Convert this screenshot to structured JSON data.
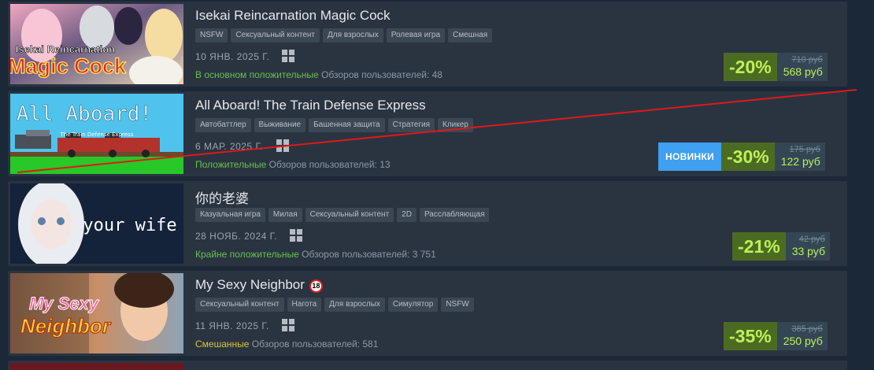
{
  "games": [
    {
      "title": "Isekai Reincarnation Magic Cock",
      "capsule_text": [
        "Isekai Reincarnation",
        "Magic Cock"
      ],
      "tags": [
        "NSFW",
        "Сексуальный контент",
        "Для взрослых",
        "Ролевая игра",
        "Смешная"
      ],
      "date": "10 ЯНВ. 2025 Г.",
      "review_summary": "В основном положительные",
      "review_count": "Обзоров пользователей: 48",
      "discount": "-20%",
      "original_price": "710 руб",
      "final_price": "568 руб"
    },
    {
      "title": "All Aboard! The Train Defense Express",
      "capsule_text": [
        "All Aboard!",
        "The Train Defense Express"
      ],
      "tags": [
        "Автобаттлер",
        "Выживание",
        "Башенная защита",
        "Стратегия",
        "Кликер"
      ],
      "date": "6 МАР. 2025 Г.",
      "review_summary": "Положительные",
      "review_count": "Обзоров пользователей: 13",
      "new_label": "НОВИНКИ",
      "discount": "-30%",
      "original_price": "175 руб",
      "final_price": "122 руб"
    },
    {
      "title": "你的老婆",
      "capsule_text": [
        "your wife"
      ],
      "tags": [
        "Казуальная игра",
        "Милая",
        "Сексуальный контент",
        "2D",
        "Расслабляющая"
      ],
      "date": "28 НОЯБ. 2024 Г.",
      "review_summary": "Крайне положительные",
      "review_count": "Обзоров пользователей: 3 751",
      "discount": "-21%",
      "original_price": "42 руб",
      "final_price": "33 руб"
    },
    {
      "title": "My Sexy Neighbor",
      "age_badge": "18",
      "capsule_text": [
        "My Sexy",
        "Neighbor"
      ],
      "tags": [
        "Сексуальный контент",
        "Нагота",
        "Для взрослых",
        "Симулятор",
        "NSFW"
      ],
      "date": "11 ЯНВ. 2025 Г.",
      "review_summary": "Смешанные",
      "review_count": "Обзоров пользователей: 581",
      "discount": "-35%",
      "original_price": "385 руб",
      "final_price": "250 руб"
    }
  ],
  "icons": {
    "platform": "windows-icon"
  },
  "colors": {
    "background": "#1b2838",
    "row": "#2a3441",
    "discount_bg": "#4c6b22",
    "discount_text": "#bef057",
    "positive": "#67c14b",
    "mixed": "#d9c832",
    "new_badge": "#3f9ff0",
    "overlay_line": "#e01818"
  }
}
